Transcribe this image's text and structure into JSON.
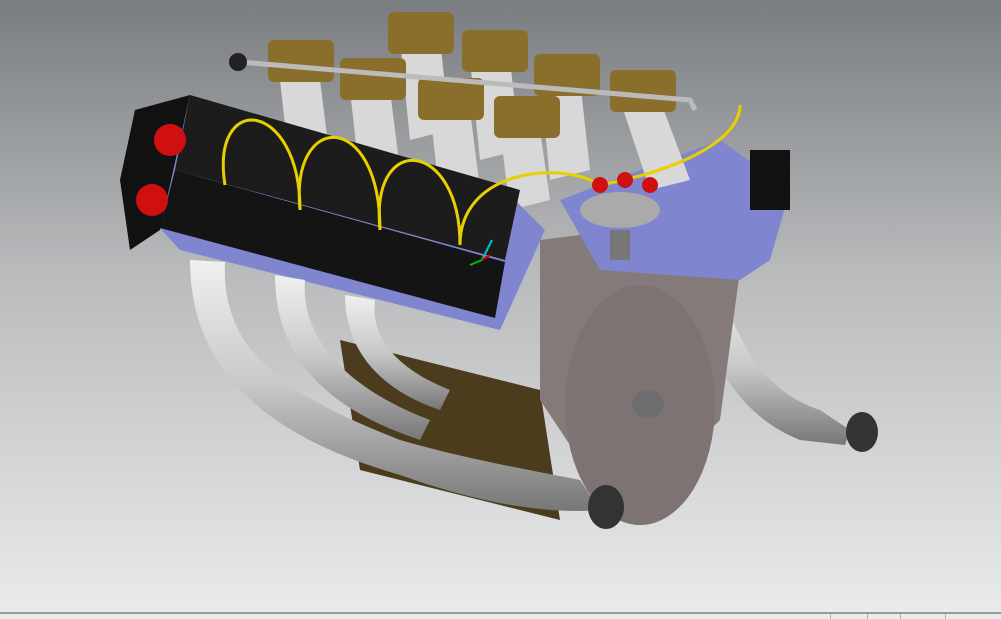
{
  "viewport": {
    "model": "v8-engine-assembly",
    "colors": {
      "background_top": "#7a7d80",
      "background_bottom": "#e9eaeb",
      "cam_cover": "#1c1c1c",
      "head_side": "#7f86cf",
      "block": "#8a7f7f",
      "exhaust": "#c9c9c9",
      "ignition_wire": "#e8d000",
      "intake_trumpet": "#8a6e2c",
      "accent_red": "#d01010"
    }
  }
}
